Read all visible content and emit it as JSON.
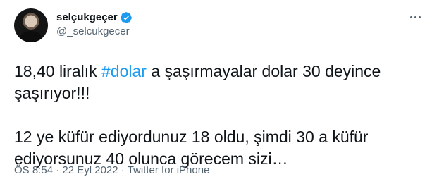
{
  "tweet": {
    "author": {
      "display_name": "selçukgeçer",
      "handle": "@_selcukgecer",
      "verified": true,
      "verified_color": "#1d9bf0"
    },
    "text": {
      "para1_before": "18,40 liralık ",
      "hashtag": "#dolar",
      "para1_after": " a şaşırmayalar dolar 30 deyince şaşırıyor!!!",
      "para2": "12 ye küfür ediyordunuz 18 oldu, şimdi 30 a küfür ediyorsunuz 40 olunca görecem sizi…"
    },
    "meta": {
      "time": "ÖS 8:54",
      "separator1": " · ",
      "date": "22 Eyl 2022",
      "separator2": " · ",
      "source": "Twitter for iPhone"
    },
    "icons": {
      "more": "more-options-icon",
      "verified": "verified-badge-icon"
    },
    "colors": {
      "text": "#0f1419",
      "secondary": "#536471",
      "link": "#1d9bf0"
    }
  }
}
